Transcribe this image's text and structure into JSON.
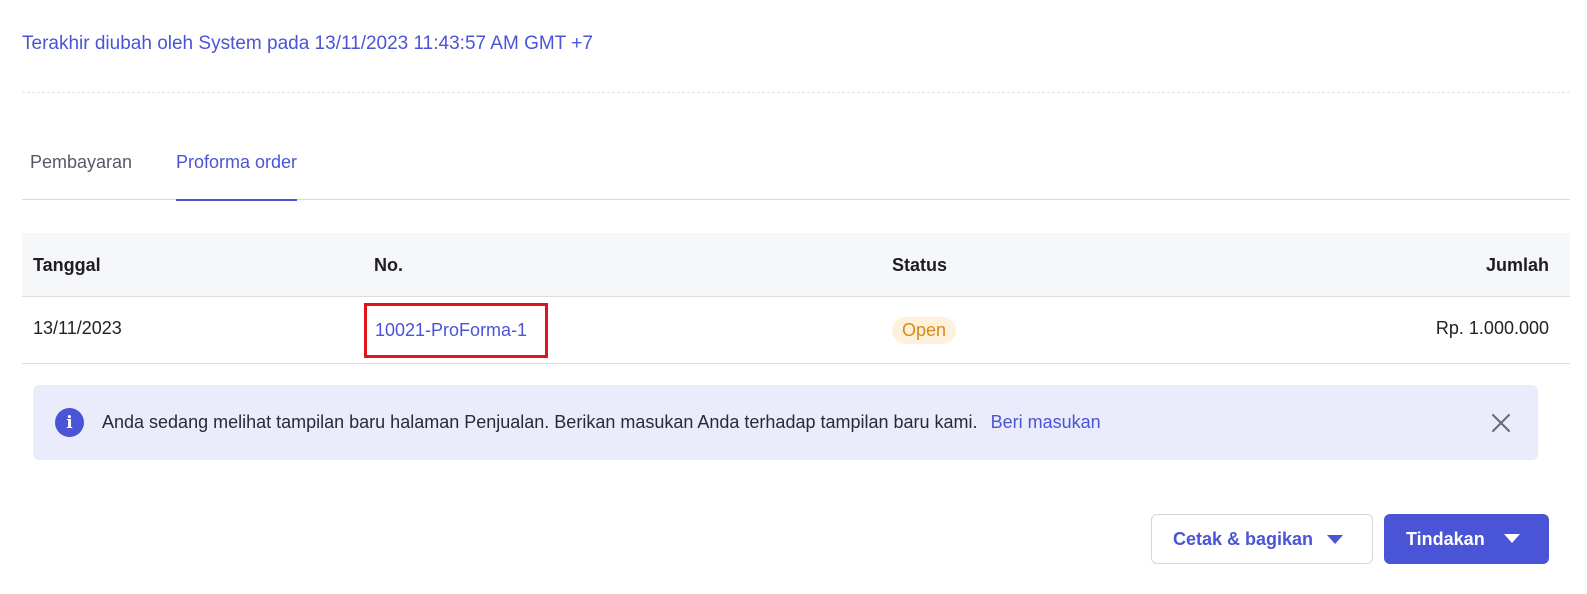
{
  "header": {
    "last_modified": "Terakhir diubah oleh System pada 13/11/2023 11:43:57 AM GMT +7"
  },
  "tabs": [
    {
      "label": "Pembayaran",
      "active": false
    },
    {
      "label": "Proforma order",
      "active": true
    }
  ],
  "table": {
    "columns": {
      "date": "Tanggal",
      "no": "No.",
      "status": "Status",
      "amount": "Jumlah"
    },
    "rows": [
      {
        "date": "13/11/2023",
        "no": "10021-ProForma-1",
        "status": "Open",
        "amount": "Rp. 1.000.000"
      }
    ]
  },
  "banner": {
    "icon": "info-icon",
    "message": "Anda sedang melihat tampilan baru halaman Penjualan. Berikan masukan Anda terhadap tampilan baru kami.",
    "link": "Beri masukan"
  },
  "actions": {
    "print_share": "Cetak & bagikan",
    "action": "Tindakan"
  },
  "colors": {
    "accent": "#4a54d6",
    "status_open_bg": "#fdf1dc",
    "status_open_text": "#d98a16",
    "highlight_border": "#e0141e",
    "banner_bg": "#ebecfb"
  }
}
